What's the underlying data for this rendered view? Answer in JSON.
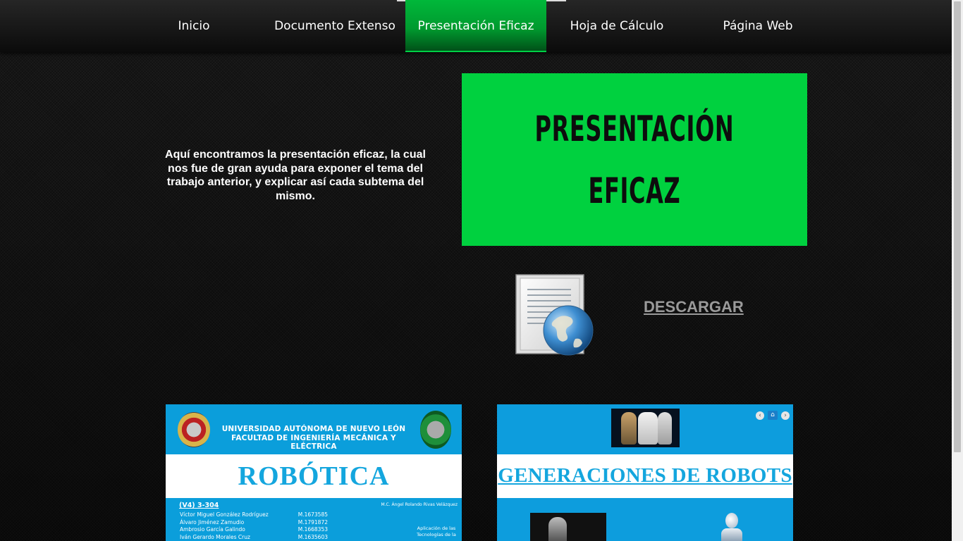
{
  "nav": {
    "items": [
      {
        "label": "Inicio",
        "active": false
      },
      {
        "label": "Documento Extenso",
        "active": false
      },
      {
        "label": "Presentación Eficaz",
        "active": true
      },
      {
        "label": "Hoja de Cálculo",
        "active": false
      },
      {
        "label": "Página Web",
        "active": false
      }
    ]
  },
  "intro": {
    "text": "Aquí encontramos la presentación eficaz, la cual nos fue de gran ayuda para exponer el tema del trabajo anterior, y explicar así cada subtema del mismo."
  },
  "banner": {
    "line1": "PRESENTACIÓN",
    "line2": "EFICAZ"
  },
  "download": {
    "label": "DESCARGAR",
    "icon": "document-globe-icon"
  },
  "slide1": {
    "university": "UNIVERSIDAD AUTÓNOMA DE NUEVO LEÓN",
    "faculty": "FACULTAD DE INGENIERÍA MECÁNICA Y ELÉCTRICA",
    "title": "ROBÓTICA",
    "group": "(V4) 3-304",
    "teacher": "M.C. Ángel Rolando Rivas Velázquez",
    "members": [
      {
        "name": "Víctor Miguel González Rodríguez",
        "id": "M.1673585"
      },
      {
        "name": "Álvaro Jiménez Zamudio",
        "id": "M.1791872"
      },
      {
        "name": "Ambrosio García Galindo",
        "id": "M.1668353"
      },
      {
        "name": "Iván Gerardo Morales Cruz",
        "id": "M.1635603"
      }
    ],
    "subject_line1": "Aplicación de las",
    "subject_line2": "Tecnologías de la"
  },
  "slide2": {
    "title": "GENERACIONES DE ROBOTS",
    "controls": {
      "prev": "‹",
      "home": "⌂",
      "next": "›"
    }
  },
  "colors": {
    "active_nav": "#00b83a",
    "banner_bg": "#00d13f",
    "slide_blue": "#0b9edb",
    "slide_title": "#14a6de"
  }
}
